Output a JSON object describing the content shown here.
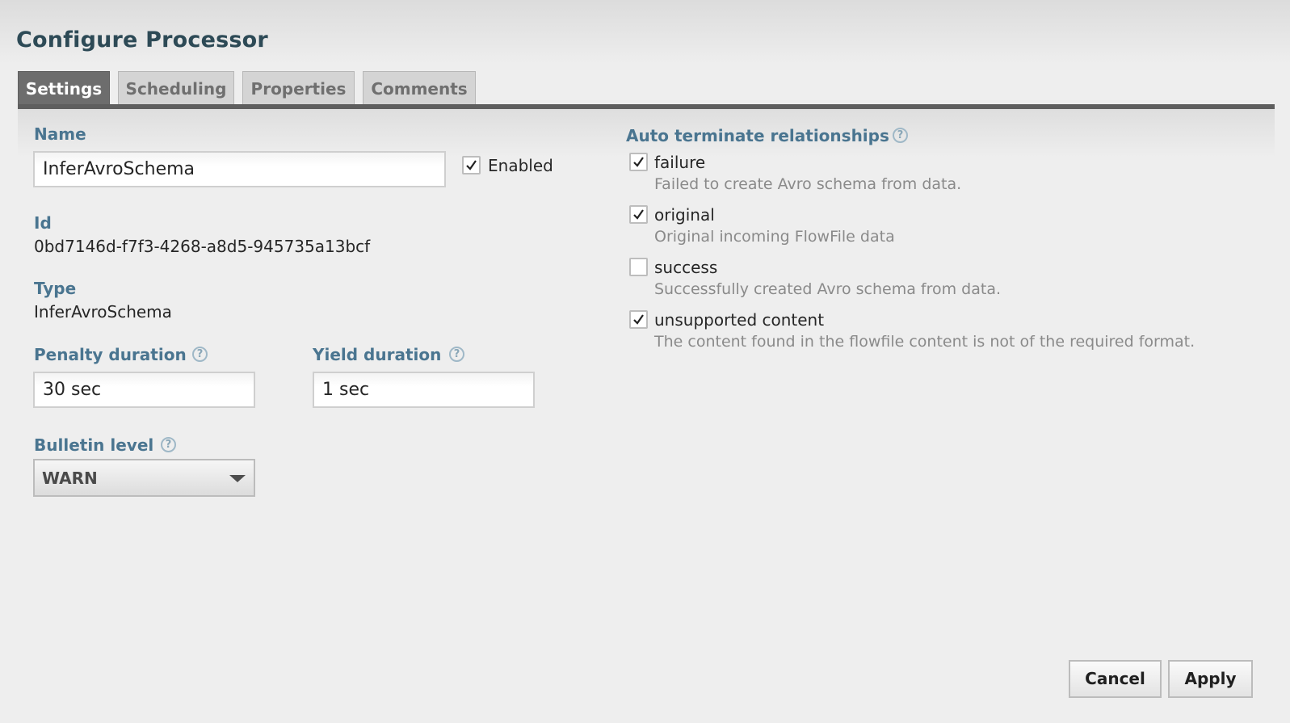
{
  "dialog": {
    "title": "Configure Processor"
  },
  "tabs": [
    {
      "label": "Settings",
      "active": true
    },
    {
      "label": "Scheduling",
      "active": false
    },
    {
      "label": "Properties",
      "active": false
    },
    {
      "label": "Comments",
      "active": false
    }
  ],
  "settings": {
    "name": {
      "label": "Name",
      "value": "InferAvroSchema"
    },
    "enabled": {
      "label": "Enabled",
      "checked": true
    },
    "id": {
      "label": "Id",
      "value": "0bd7146d-f7f3-4268-a8d5-945735a13bcf"
    },
    "type": {
      "label": "Type",
      "value": "InferAvroSchema"
    },
    "penalty": {
      "label": "Penalty duration",
      "value": "30 sec"
    },
    "yield": {
      "label": "Yield duration",
      "value": "1 sec"
    },
    "bulletin": {
      "label": "Bulletin level",
      "value": "WARN"
    },
    "help_glyph": "?"
  },
  "auto_terminate": {
    "label": "Auto terminate relationships",
    "relationships": [
      {
        "name": "failure",
        "description": "Failed to create Avro schema from data.",
        "checked": true
      },
      {
        "name": "original",
        "description": "Original incoming FlowFile data",
        "checked": true
      },
      {
        "name": "success",
        "description": "Successfully created Avro schema from data.",
        "checked": false
      },
      {
        "name": "unsupported content",
        "description": "The content found in the flowfile content is not of the required format.",
        "checked": true
      }
    ]
  },
  "buttons": {
    "cancel": "Cancel",
    "apply": "Apply"
  },
  "colors": {
    "label": "#4a7590",
    "title": "#2d4a56",
    "active_tab": "#6d6d6d"
  },
  "icons": {
    "help": "help-icon",
    "check": "checkmark-icon",
    "dropdown": "chevron-down-icon"
  }
}
